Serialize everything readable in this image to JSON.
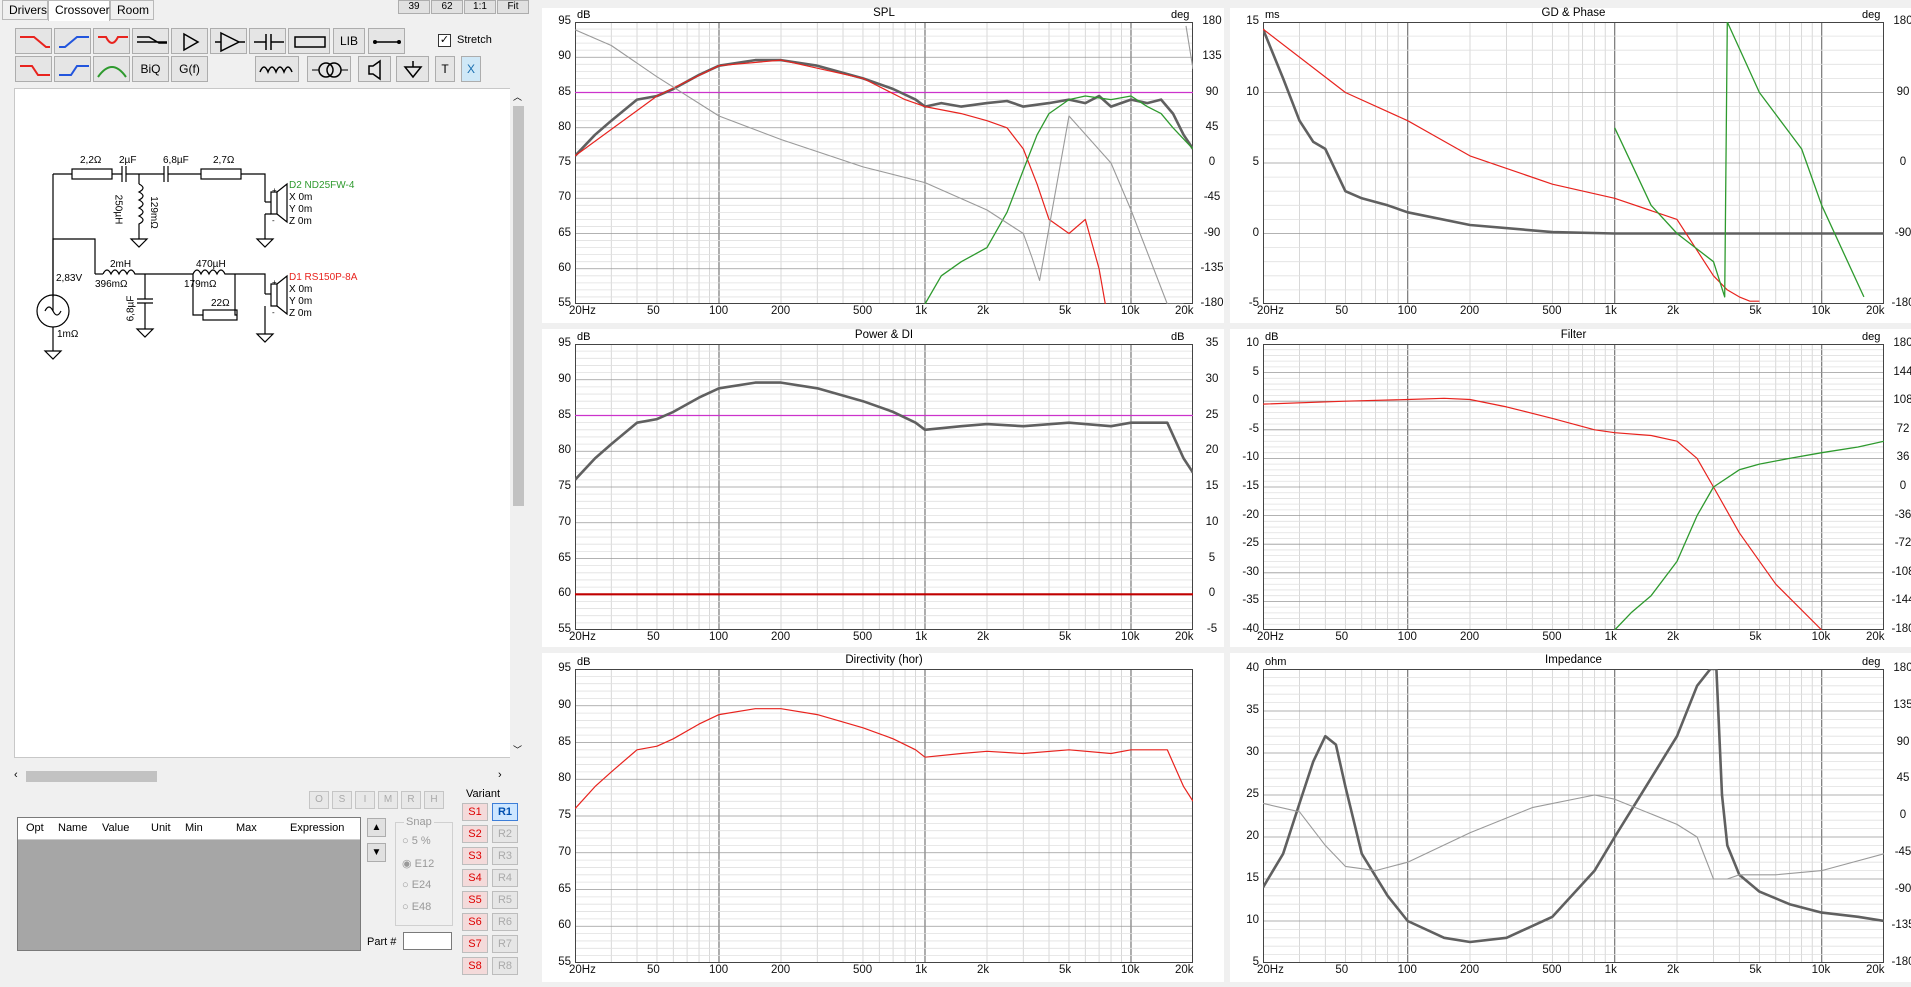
{
  "tabs": [
    {
      "label": "Drivers"
    },
    {
      "label": "Crossover"
    },
    {
      "label": "Room"
    }
  ],
  "top_buttons": [
    "39",
    "62",
    "1:1",
    "Fit"
  ],
  "toolbar": {
    "biq": "BiQ",
    "gf": "G(f)",
    "lib": "LIB",
    "t": "T",
    "x": "X",
    "stretch": "Stretch"
  },
  "schematic": {
    "parts": {
      "r1": "2,2Ω",
      "c1": "2µF",
      "c2": "6,8µF",
      "r2": "2,7Ω",
      "l1": "250µH",
      "l1r": "129mΩ",
      "source_v": "2,83V",
      "source_r": "1mΩ",
      "l2": "2mH",
      "l2r": "396mΩ",
      "c3": "6,8µF",
      "l3": "470µH",
      "l3r": "179mΩ",
      "r3": "22Ω"
    },
    "tweeter": {
      "name": "D2 ND25FW-4",
      "x": "X 0m",
      "y": "Y 0m",
      "z": "Z 0m"
    },
    "woofer": {
      "name": "D1 RS150P-8A",
      "x": "X 0m",
      "y": "Y 0m",
      "z": "Z 0m"
    }
  },
  "opt_buttons": [
    "O",
    "S",
    "I",
    "M",
    "R",
    "H"
  ],
  "params_table": {
    "headers": [
      "Opt",
      "Name",
      "Value",
      "Unit",
      "Min",
      "Max",
      "Expression"
    ]
  },
  "snap": {
    "label": "Snap",
    "options": [
      "5 %",
      "E12",
      "E24",
      "E48"
    ],
    "selected": "E12"
  },
  "part_label": "Part #",
  "variant": {
    "label": "Variant",
    "s": [
      "S1",
      "S2",
      "S3",
      "S4",
      "S5",
      "S6",
      "S7",
      "S8"
    ],
    "r": [
      "R1",
      "R2",
      "R3",
      "R4",
      "R5",
      "R6",
      "R7",
      "R8"
    ],
    "selected": "R1"
  },
  "colors": {
    "woofer": "#e8231e",
    "tweeter": "#2e9a2e",
    "sum": "#5a5a5a",
    "target": "#cc33cc",
    "red_line": "#c00000",
    "bg": "#ffffff"
  },
  "xticks": [
    "20Hz",
    "50",
    "100",
    "200",
    "500",
    "1k",
    "2k",
    "5k",
    "10k",
    "20k"
  ],
  "chart_data": [
    {
      "type": "line",
      "title": "SPL",
      "yunit_left": "dB",
      "yunit_right": "deg",
      "ylim": [
        55,
        95
      ],
      "yticks": [
        "95",
        "90",
        "85",
        "80",
        "75",
        "70",
        "65",
        "60",
        "55"
      ],
      "yticks_right": [
        "180",
        "135",
        "90",
        "45",
        "0",
        "-45",
        "-90",
        "-135",
        "-180"
      ],
      "xscale": "log",
      "xlim": [
        20,
        20000
      ],
      "series": [
        {
          "color": "sum",
          "x": [
            20,
            25,
            30,
            40,
            50,
            60,
            80,
            100,
            150,
            200,
            300,
            500,
            700,
            900,
            1000,
            1200,
            1500,
            2000,
            2500,
            3000,
            4000,
            5000,
            6000,
            7000,
            8000,
            10000,
            12000,
            14000,
            16000,
            18000,
            20000
          ],
          "y": [
            76,
            79,
            81,
            84,
            84.5,
            85.5,
            87.5,
            88.8,
            89.6,
            89.6,
            88.8,
            87,
            85.5,
            84,
            83,
            83.5,
            83,
            83.5,
            83.8,
            83,
            83.5,
            84,
            83.5,
            84.5,
            83,
            84,
            83.5,
            84,
            82,
            79,
            77
          ]
        },
        {
          "color": "woofer",
          "x": [
            20,
            50,
            100,
            200,
            500,
            800,
            1000,
            1500,
            2000,
            2500,
            3000,
            3500,
            4000,
            5000,
            6000,
            7000,
            7500
          ],
          "y": [
            76,
            84.5,
            88.8,
            89.6,
            87,
            84,
            83,
            82,
            81,
            80,
            77,
            72,
            67,
            65,
            67,
            60,
            55
          ]
        },
        {
          "color": "tweeter",
          "x": [
            1000,
            1200,
            1500,
            2000,
            2500,
            3000,
            3500,
            4000,
            5000,
            6000,
            8000,
            10000,
            12000,
            14000,
            16000,
            20000
          ],
          "y": [
            55,
            59,
            61,
            63,
            68,
            74,
            79,
            82,
            84,
            84.5,
            84,
            84.5,
            83,
            82,
            80,
            77
          ]
        },
        {
          "color": "phase",
          "x": [
            20,
            30,
            50,
            100,
            200,
            500,
            1000,
            2000,
            3000,
            3300,
            3600,
            5000,
            8000,
            10000,
            15000,
            18000,
            18500,
            20000
          ],
          "y": [
            170,
            150,
            110,
            60,
            30,
            -5,
            -25,
            -60,
            -90,
            -120,
            -150,
            60,
            0,
            -60,
            -180,
            -180,
            175,
            120
          ]
        }
      ]
    },
    {
      "type": "line",
      "title": "GD & Phase",
      "yunit_left": "ms",
      "yunit_right": "deg",
      "ylim": [
        -5,
        15
      ],
      "yticks": [
        "15",
        "10",
        "5",
        "0",
        "-5"
      ],
      "yticks_right": [
        "180",
        "90",
        "0",
        "-90",
        "-180"
      ],
      "xscale": "log",
      "xlim": [
        20,
        20000
      ],
      "series": [
        {
          "color": "sum",
          "x": [
            20,
            25,
            30,
            35,
            40,
            50,
            60,
            80,
            100,
            200,
            500,
            1000,
            2000,
            20000
          ],
          "y": [
            14.5,
            11,
            8,
            6.5,
            6,
            3,
            2.5,
            2,
            1.5,
            0.6,
            0.1,
            0,
            0,
            0
          ]
        },
        {
          "color": "woofer",
          "x": [
            20,
            50,
            100,
            200,
            500,
            1000,
            2000,
            3000,
            3500,
            4000,
            4500,
            5000
          ],
          "y": [
            14.5,
            10,
            8,
            5.5,
            3.5,
            2.5,
            1,
            -3,
            -4,
            -4.5,
            -4.8,
            -4.8
          ]
        },
        {
          "color": "tweeter",
          "x": [
            1000,
            1500,
            2000,
            3000,
            3400,
            3500,
            5000,
            8000,
            10000,
            16000
          ],
          "y": [
            7.5,
            2,
            0,
            -2,
            -4.5,
            15,
            10,
            6,
            2,
            -4.5
          ]
        }
      ]
    },
    {
      "type": "line",
      "title": "Power & DI",
      "yunit_left": "dB",
      "yunit_right": "dB",
      "ylim": [
        55,
        95
      ],
      "yticks": [
        "95",
        "90",
        "85",
        "80",
        "75",
        "70",
        "65",
        "60",
        "55"
      ],
      "yticks_right": [
        "35",
        "30",
        "25",
        "20",
        "15",
        "10",
        "5",
        "0",
        "-5"
      ],
      "xscale": "log",
      "xlim": [
        20,
        20000
      ],
      "series": [
        {
          "color": "sum",
          "x": [
            20,
            25,
            30,
            40,
            50,
            60,
            80,
            100,
            150,
            200,
            300,
            500,
            700,
            900,
            1000,
            1500,
            2000,
            3000,
            5000,
            8000,
            10000,
            15000,
            18000,
            20000
          ],
          "y": [
            76,
            79,
            81,
            84,
            84.5,
            85.5,
            87.5,
            88.8,
            89.6,
            89.6,
            88.8,
            87,
            85.5,
            84,
            83,
            83.5,
            83.8,
            83.5,
            84,
            83.5,
            84,
            84,
            79,
            77
          ]
        },
        {
          "color": "red_line",
          "x": [
            20,
            20000
          ],
          "y": [
            60,
            60
          ]
        }
      ]
    },
    {
      "type": "line",
      "title": "Filter",
      "yunit_left": "dB",
      "yunit_right": "deg",
      "ylim": [
        -40,
        10
      ],
      "yticks": [
        "10",
        "5",
        "0",
        "-5",
        "-10",
        "-15",
        "-20",
        "-25",
        "-30",
        "-35",
        "-40"
      ],
      "yticks_right": [
        "180",
        "144",
        "108",
        "72",
        "36",
        "0",
        "-36",
        "-72",
        "-108",
        "-144",
        "-180"
      ],
      "xscale": "log",
      "xlim": [
        20,
        20000
      ],
      "series": [
        {
          "color": "woofer",
          "x": [
            20,
            50,
            100,
            150,
            200,
            300,
            500,
            800,
            1000,
            1500,
            2000,
            2500,
            3000,
            4000,
            6000,
            10000
          ],
          "y": [
            -0.5,
            0,
            0.3,
            0.5,
            0.3,
            -1,
            -3,
            -5,
            -5.5,
            -6,
            -7,
            -10,
            -15,
            -23,
            -32,
            -40
          ]
        },
        {
          "color": "tweeter",
          "x": [
            1000,
            1200,
            1500,
            2000,
            2500,
            3000,
            4000,
            5000,
            7000,
            10000,
            15000,
            20000
          ],
          "y": [
            -40,
            -37,
            -34,
            -28,
            -20,
            -15,
            -12,
            -11,
            -10,
            -9,
            -8,
            -7
          ]
        }
      ]
    },
    {
      "type": "line",
      "title": "Directivity (hor)",
      "yunit_left": "dB",
      "ylim": [
        55,
        95
      ],
      "yticks": [
        "95",
        "90",
        "85",
        "80",
        "75",
        "70",
        "65",
        "60",
        "55"
      ],
      "xscale": "log",
      "xlim": [
        20,
        20000
      ],
      "series": [
        {
          "color": "woofer",
          "x": [
            20,
            25,
            30,
            40,
            50,
            60,
            80,
            100,
            150,
            200,
            300,
            500,
            700,
            900,
            1000,
            1500,
            2000,
            3000,
            5000,
            8000,
            10000,
            15000,
            18000,
            20000
          ],
          "y": [
            76,
            79,
            81,
            84,
            84.5,
            85.5,
            87.5,
            88.8,
            89.6,
            89.6,
            88.8,
            87,
            85.5,
            84,
            83,
            83.5,
            83.8,
            83.5,
            84,
            83.5,
            84,
            84,
            79,
            77
          ]
        }
      ]
    },
    {
      "type": "line",
      "title": "Impedance",
      "yunit_left": "ohm",
      "yunit_right": "deg",
      "ylim": [
        5,
        40
      ],
      "yticks": [
        "40",
        "35",
        "30",
        "25",
        "20",
        "15",
        "10",
        "5"
      ],
      "yticks_right": [
        "180",
        "135",
        "90",
        "45",
        "0",
        "-45",
        "-90",
        "-135",
        "-180"
      ],
      "xscale": "log",
      "xlim": [
        20,
        20000
      ],
      "series": [
        {
          "color": "sum",
          "x": [
            20,
            25,
            30,
            35,
            40,
            45,
            50,
            60,
            80,
            100,
            150,
            200,
            300,
            500,
            800,
            1000,
            1500,
            2000,
            2500,
            2900,
            3100,
            3300,
            3500,
            4000,
            5000,
            7000,
            10000,
            15000,
            20000
          ],
          "y": [
            14,
            18,
            24,
            29,
            32,
            31,
            26,
            18,
            13,
            10,
            8,
            7.5,
            8,
            10.5,
            16,
            20,
            27,
            32,
            38,
            40,
            40,
            25,
            19,
            15.5,
            13.5,
            12,
            11,
            10.5,
            10
          ]
        },
        {
          "color": "thin",
          "x": [
            20,
            30,
            40,
            50,
            70,
            100,
            200,
            400,
            800,
            1000,
            2000,
            2500,
            3000,
            3500,
            4000,
            6000,
            10000,
            20000
          ],
          "y": [
            24,
            23,
            19,
            16.5,
            16,
            17,
            20.5,
            23.5,
            25,
            24.5,
            21.5,
            20,
            15,
            15,
            15.5,
            15.5,
            16,
            18
          ]
        }
      ]
    }
  ]
}
